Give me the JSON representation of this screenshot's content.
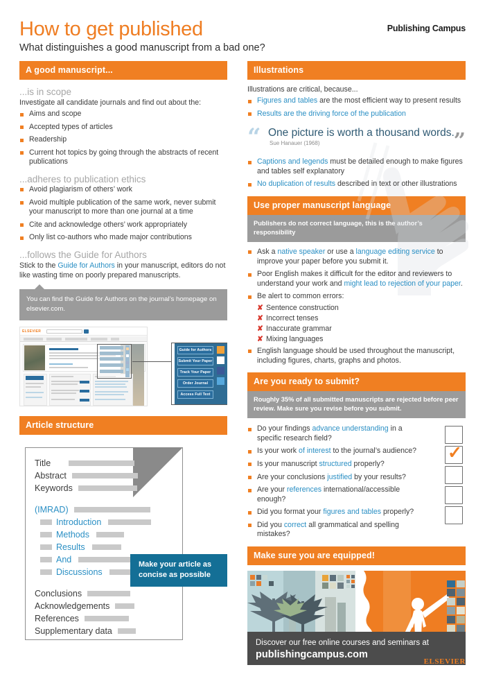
{
  "header": {
    "title": "How to get published",
    "subtitle": "What distinguishes a good manuscript from a bad one?",
    "brand": "Publishing Campus"
  },
  "left": {
    "section_good": {
      "bar": "A good manuscript..."
    },
    "scope": {
      "heading": "...is in scope",
      "lead": "Investigate all candidate journals and find out about the:",
      "items": [
        "Aims and scope",
        "Accepted types of articles",
        "Readership",
        "Current hot topics by going through the abstracts of recent publications"
      ]
    },
    "ethics": {
      "heading": "...adheres to publication ethics",
      "items": [
        "Avoid plagiarism of others’ work",
        "Avoid multiple publication of the same work, never submit your manuscript to more than one journal at a time",
        "Cite and acknowledge others’ work appropriately",
        "Only list co-authors who made major contributions"
      ]
    },
    "guide": {
      "heading": "...follows the Guide for Authors",
      "lead_pre": "Stick to the ",
      "lead_link": "Guide for Authors",
      "lead_post": " in your manuscript, editors do not like wasting time on poorly prepared manuscripts.",
      "callout": "You can find the Guide for Authors  on the journal’s homepage on elsevier.com."
    },
    "mock": {
      "logo": "ELSEVIER",
      "buttons": [
        "Guide for Authors",
        "Submit Your Paper",
        "Track Your Paper",
        "Order Journal",
        "Access Full Text"
      ]
    },
    "article_structure": {
      "bar": "Article structure",
      "rows_top": [
        "Title",
        "Abstract",
        "Keywords"
      ],
      "imrad_label": "(IMRAD)",
      "imrad_rows": [
        "Introduction",
        "Methods",
        "Results",
        "And",
        "Discussions"
      ],
      "rows_bottom": [
        "Conclusions",
        "Acknowledgements",
        "References",
        "Supplementary data"
      ],
      "tip": "Make your article as concise as possible"
    }
  },
  "right": {
    "illustrations": {
      "bar": "Illustrations",
      "lead": "Illustrations are critical, because...",
      "items": [
        {
          "link": "Figures and tables",
          "rest": " are the most efficient way to present results"
        },
        {
          "link": "Results",
          "rest": " are the driving force of the publication"
        }
      ],
      "quote": "One picture is worth a thousand words.",
      "quote_cite": "Sue Hanauer (1968)",
      "quote_open": "“",
      "quote_close": "”",
      "items2": [
        {
          "link": "Captions and legends",
          "rest": " must be detailed enough to make figures and tables self explanatory"
        },
        {
          "link": "No duplication of results",
          "rest": " described in text or other illustrations"
        }
      ]
    },
    "language": {
      "bar": "Use proper manuscript language",
      "subbar": "Publishers do not correct language, this is the author’s responsibility",
      "item1_a": "Ask a ",
      "item1_link1": "native speaker",
      "item1_b": " or use a ",
      "item1_link2": "language editing service",
      "item1_c": " to improve your paper before you submit it.",
      "item2_a": "Poor English makes it difficult for the editor and reviewers to understand your work and ",
      "item2_link": "might lead to rejection of your paper",
      "item2_b": ".",
      "item3": "Be alert to common errors:",
      "errors": [
        "Sentence construction",
        "Incorrect tenses",
        "Inaccurate grammar",
        "Mixing languages"
      ],
      "error_mark": "✘",
      "item4": "English language should be used throughout the manuscript, including figures, charts, graphs and photos."
    },
    "submit": {
      "bar": "Are you ready to submit?",
      "subbar_a": "Roughly ",
      "subbar_pct": "35%",
      "subbar_b": " of all submitted manuscripts are ",
      "subbar_c": "rejected before peer review",
      "subbar_d": ". Make sure you revise before you submit.",
      "checklist": [
        {
          "pre": "Do your findings ",
          "link": "advance understanding",
          "post": " in a specific research field?",
          "checked": false
        },
        {
          "pre": "Is your work ",
          "link": "of interest",
          "post": " to the journal’s audience?",
          "checked": true
        },
        {
          "pre": "Is your manuscript ",
          "link": "structured",
          "post": " properly?",
          "checked": false
        },
        {
          "pre": "Are your conclusions ",
          "link": "justified",
          "post": " by your results?",
          "checked": false
        },
        {
          "pre": "Are your ",
          "link": "references",
          "post": " international/accessible enough?",
          "checked": false
        },
        {
          "pre": "Did you format your ",
          "link": "figures and tables",
          "post": " properly?",
          "checked": false
        },
        {
          "pre": "Did you ",
          "link": "correct",
          "post": " all grammatical and spelling mistakes?",
          "checked": false
        }
      ],
      "check_mark": "✓"
    },
    "banner": {
      "bar": "Make sure you are equipped!",
      "line1": "Discover our free online courses and seminars at",
      "line2": "publishingcampus.com"
    }
  },
  "footer": {
    "logo": "ELSEVIER"
  },
  "colors": {
    "orange": "#f07f22",
    "blue": "#2a8fc4",
    "teal": "#146f96",
    "gray_bar": "#9b9b9b",
    "red": "#d8352a"
  }
}
